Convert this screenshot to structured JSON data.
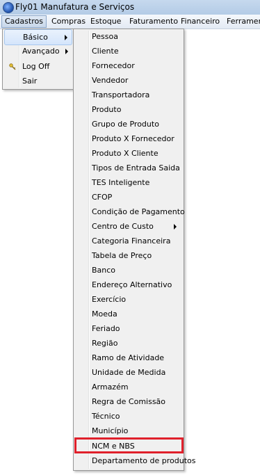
{
  "window": {
    "title": "Fly01 Manufatura e Serviços"
  },
  "menubar": {
    "items": [
      "Cadastros",
      "Compras",
      "Estoque",
      "Faturamento",
      "Financeiro",
      "Ferramentas"
    ]
  },
  "cadastros_menu": {
    "items": [
      {
        "label": "Básico",
        "submenu": true,
        "selected": true
      },
      {
        "label": "Avançado",
        "submenu": true
      },
      {
        "label": "Log Off",
        "icon": "key-icon"
      },
      {
        "label": "Sair"
      }
    ]
  },
  "basico_menu": {
    "items": [
      "Pessoa",
      "Cliente",
      "Fornecedor",
      "Vendedor",
      "Transportadora",
      "Produto",
      "Grupo de Produto",
      "Produto X Fornecedor",
      "Produto X Cliente",
      "Tipos de Entrada Saida",
      "TES Inteligente",
      "CFOP",
      "Condição de Pagamento",
      "Centro de Custo",
      "Categoria Financeira",
      "Tabela de Preço",
      "Banco",
      "Endereço Alternativo",
      "Exercício",
      "Moeda",
      "Feriado",
      "Região",
      "Ramo de Atividade",
      "Unidade de Medida",
      "Armazém",
      "Regra de Comissão",
      "Técnico",
      "Município",
      "NCM e NBS",
      "Departamento de produtos"
    ],
    "submenu_item": "Centro de Custo",
    "highlighted_item": "NCM e NBS",
    "highlight_color": "#e0202b"
  }
}
